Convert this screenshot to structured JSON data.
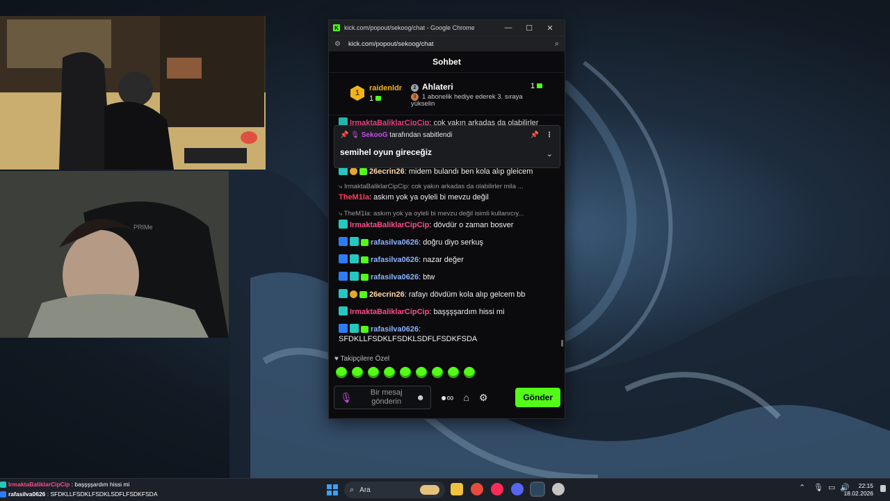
{
  "window": {
    "title": "kick.com/popout/sekoog/chat - Google Chrome",
    "url": "kick.com/popout/sekoog/chat",
    "minimize": "—",
    "maximize": "☐",
    "close": "✕"
  },
  "chat": {
    "header": "Sohbet",
    "leaderboard": {
      "first_rank": "1",
      "first_name": "raidenldr",
      "first_count": "1",
      "second_rank": "2",
      "second_name": "Ahlateri",
      "second_count": "1",
      "third_rank": "3",
      "third_text": "1 abonelik hediye ederek 3. sıraya yükselin"
    },
    "pinned": {
      "author": "SekooG",
      "by_text": "tarafından sabitlendi",
      "text": "semihel oyun gireceğiz"
    },
    "messages": [
      {
        "user": "26ecrin26",
        "color": "#ffd9a6",
        "text": ": midem bulandı ben kola alıp gleicem"
      },
      {
        "reply": "IrmaktaBaliklarCipCip: cok yakın arkadas da olabilirler mila ..."
      },
      {
        "user": "TheM1la",
        "color": "#ff3d5a",
        "text": ": askım yok ya oyleli bi mevzu değil"
      },
      {
        "reply": "TheM1la: askım yok ya oyleli bi mevzu değil isimli kullanıcıy..."
      },
      {
        "user": "IrmaktaBaliklarCipCip",
        "color": "#ff4a8a",
        "text": ": dövdür o zaman bosver"
      },
      {
        "user": "rafasilva0626",
        "color": "#8ab4ff",
        "text": ": doğru diyo serkuş"
      },
      {
        "user": "rafasilva0626",
        "color": "#8ab4ff",
        "text": ": nazar değer"
      },
      {
        "user": "rafasilva0626",
        "color": "#8ab4ff",
        "text": ": btw"
      },
      {
        "user": "26ecrin26",
        "color": "#ffd9a6",
        "text": ": rafayı dövdüm kola alıp gelcem bb"
      },
      {
        "user": "IrmaktaBaliklarCipCip",
        "color": "#ff4a8a",
        "text": ": başşşşardım hissi mi"
      },
      {
        "user": "rafasilva0626",
        "color": "#8ab4ff",
        "text": ":"
      },
      {
        "text": "SFDKLLFSDKLFSDKLSDFLFSDKFSDA"
      }
    ],
    "top_partial_user": "IrmaktaBaliklarCipCip",
    "top_partial_text": ": cok yakın arkadas da olabilirler",
    "followers_label": "Takipçilere Özel",
    "input_placeholder": "Bir mesaj gönderin",
    "send_label": "Gönder"
  },
  "overlay": {
    "line1_user": "IrmaktaBaliklarCipCip",
    "line1_text": " : başşşşardım hissi mi",
    "line2_user": "rafasilva0626",
    "line2_text": " : SFDKLLFSDKLFSDKLSDFLFSDKFSDA"
  },
  "taskbar": {
    "search_label": "Ara",
    "time": "22:15",
    "date": "18.02.2026"
  },
  "colors": {
    "kick_green": "#53fc18",
    "pin_author": "#c94fe8"
  }
}
